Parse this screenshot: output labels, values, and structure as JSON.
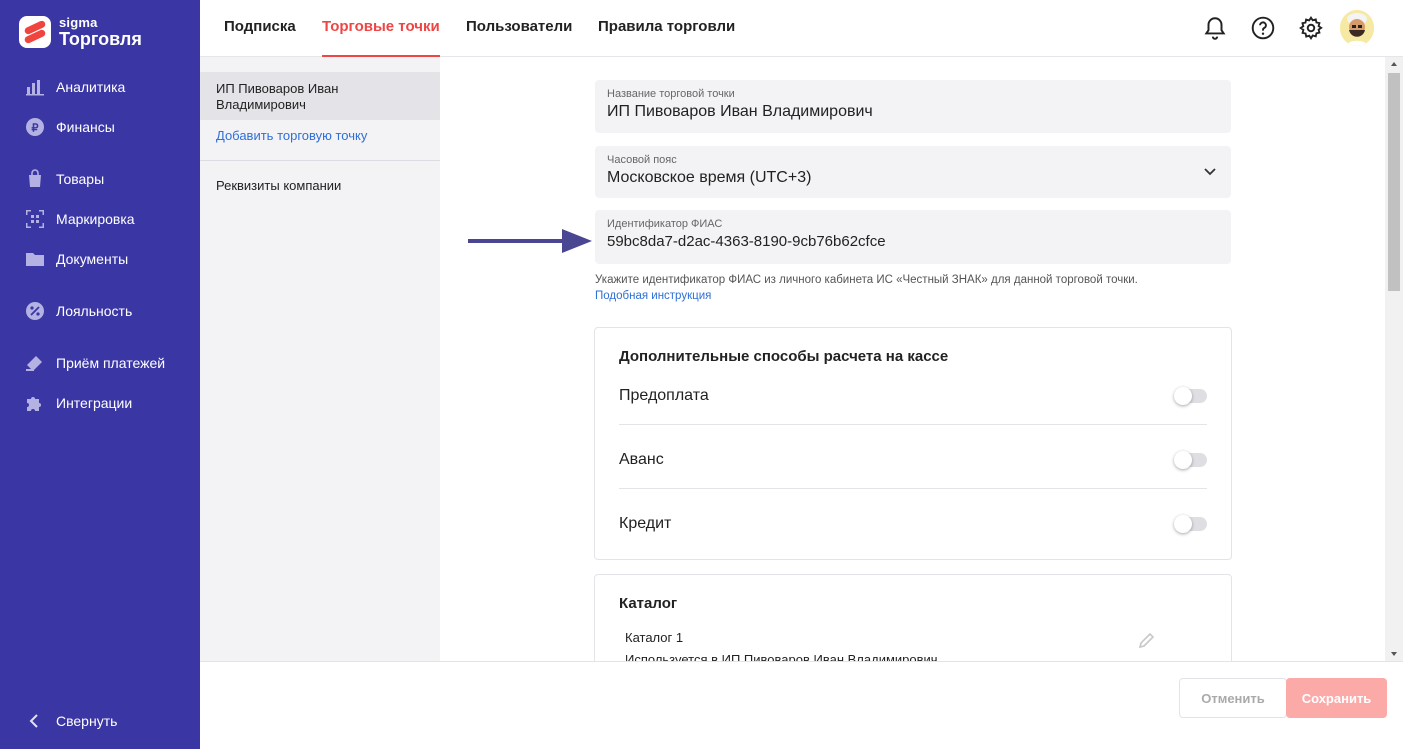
{
  "brand": {
    "small": "sigma",
    "big": "Торговля",
    "accent": "#3a36a3",
    "red": "#ee4545"
  },
  "sidebar": {
    "items": [
      {
        "label": "Аналитика",
        "icon": "bar-chart-icon"
      },
      {
        "label": "Финансы",
        "icon": "ruble-coin-icon"
      },
      {
        "label": "Товары",
        "icon": "shopping-bag-icon"
      },
      {
        "label": "Маркировка",
        "icon": "qr-code-icon"
      },
      {
        "label": "Документы",
        "icon": "folder-icon"
      },
      {
        "label": "Лояльность",
        "icon": "percent-badge-icon"
      },
      {
        "label": "Приём платежей",
        "icon": "card-payment-icon"
      },
      {
        "label": "Интеграции",
        "icon": "puzzle-icon"
      }
    ],
    "collapse_label": "Свернуть"
  },
  "topbar": {
    "tabs": [
      {
        "label": "Подписка"
      },
      {
        "label": "Торговые точки"
      },
      {
        "label": "Пользователи"
      },
      {
        "label": "Правила торговли"
      }
    ]
  },
  "subnav": {
    "selected": "ИП Пивоваров Иван Владимирович",
    "add_link": "Добавить торговую точку",
    "company": "Реквизиты компании"
  },
  "form": {
    "name": {
      "label": "Название торговой точки",
      "value": "ИП Пивоваров Иван Владимирович"
    },
    "timezone": {
      "label": "Часовой пояс",
      "value": "Московское время (UTC+3)"
    },
    "fias": {
      "label": "Идентификатор ФИАС",
      "value": "59bc8da7-d2ac-4363-8190-9cb76b62cfce"
    },
    "hint": "Укажите идентификатор ФИАС из личного кабинета ИС «Честный ЗНАК» для данной торговой точки.",
    "hint_link": "Подобная инструкция"
  },
  "payments": {
    "title": "Дополнительные способы расчета на кассе",
    "options": [
      {
        "label": "Предоплата",
        "enabled": false
      },
      {
        "label": "Аванс",
        "enabled": false
      },
      {
        "label": "Кредит",
        "enabled": false
      }
    ]
  },
  "catalog": {
    "title": "Каталог",
    "name": "Каталог 1",
    "usage": "Используется в ИП Пивоваров Иван Владимирович"
  },
  "footer": {
    "cancel": "Отменить",
    "save": "Сохранить"
  }
}
